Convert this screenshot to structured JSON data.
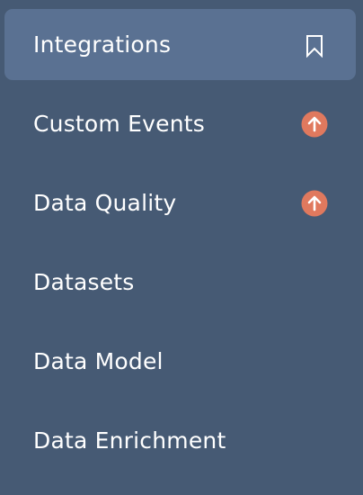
{
  "sidebar": {
    "items": [
      {
        "label": "Integrations",
        "icon": "bookmark-icon",
        "active": true
      },
      {
        "label": "Custom Events",
        "icon": "upgrade-arrow-icon",
        "active": false
      },
      {
        "label": "Data Quality",
        "icon": "upgrade-arrow-icon",
        "active": false
      },
      {
        "label": "Datasets",
        "icon": null,
        "active": false
      },
      {
        "label": "Data Model",
        "icon": null,
        "active": false
      },
      {
        "label": "Data Enrichment",
        "icon": null,
        "active": false
      }
    ]
  },
  "colors": {
    "sidebar_background": "#465a74",
    "active_background": "#5a7192",
    "text": "#ffffff",
    "upgrade_badge": "#e0795e"
  }
}
